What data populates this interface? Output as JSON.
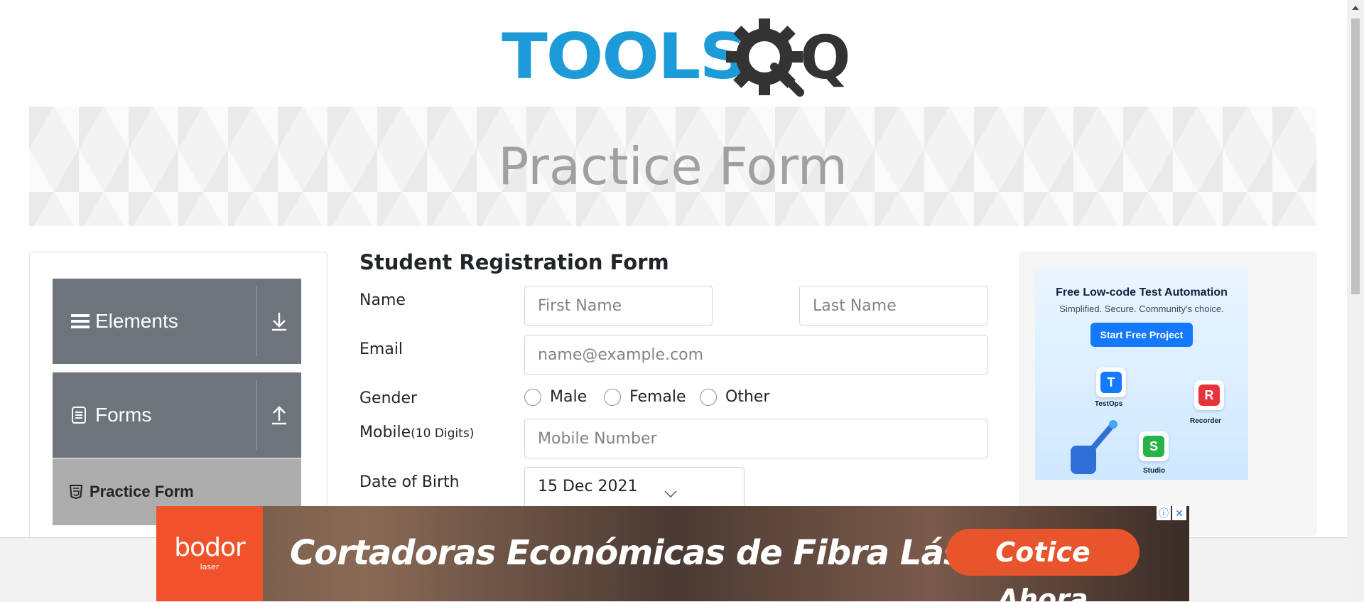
{
  "logo": {
    "text": "TOOLS",
    "suffix": "QA"
  },
  "banner": {
    "title": "Practice Form"
  },
  "sidebar": {
    "groups": [
      {
        "label": "Elements",
        "icon": "hamburger-icon",
        "toggle_icon": "download-arrow-icon"
      },
      {
        "label": "Forms",
        "icon": "document-icon",
        "toggle_icon": "upload-arrow-icon"
      }
    ],
    "active_item": {
      "label": "Practice Form",
      "icon": "html5-icon"
    }
  },
  "form": {
    "title": "Student Registration Form",
    "name_label": "Name",
    "first_name_placeholder": "First Name",
    "last_name_placeholder": "Last Name",
    "email_label": "Email",
    "email_placeholder": "name@example.com",
    "gender_label": "Gender",
    "gender_options": [
      "Male",
      "Female",
      "Other"
    ],
    "mobile_label": "Mobile",
    "mobile_hint": "(10 Digits)",
    "mobile_placeholder": "Mobile Number",
    "dob_label": "Date of Birth",
    "dob_value": "15 Dec 2021"
  },
  "right_ad": {
    "headline": "Free Low-code Test Automation",
    "subline": "Simplified. Secure. Community's choice.",
    "cta": "Start Free Project",
    "products": [
      "TestOps",
      "Recorder",
      "Studio"
    ]
  },
  "bottom_ad": {
    "brand": "bodor",
    "brand_sub": "laser",
    "slogan": "Cortadoras Económicas de Fibra Láser",
    "cta": "Cotice Ahora"
  },
  "colors": {
    "accent": "#1d9bd8",
    "sidebar_header": "#6e747c",
    "sidebar_active": "#adadad",
    "ad_orange": "#f0532b"
  }
}
